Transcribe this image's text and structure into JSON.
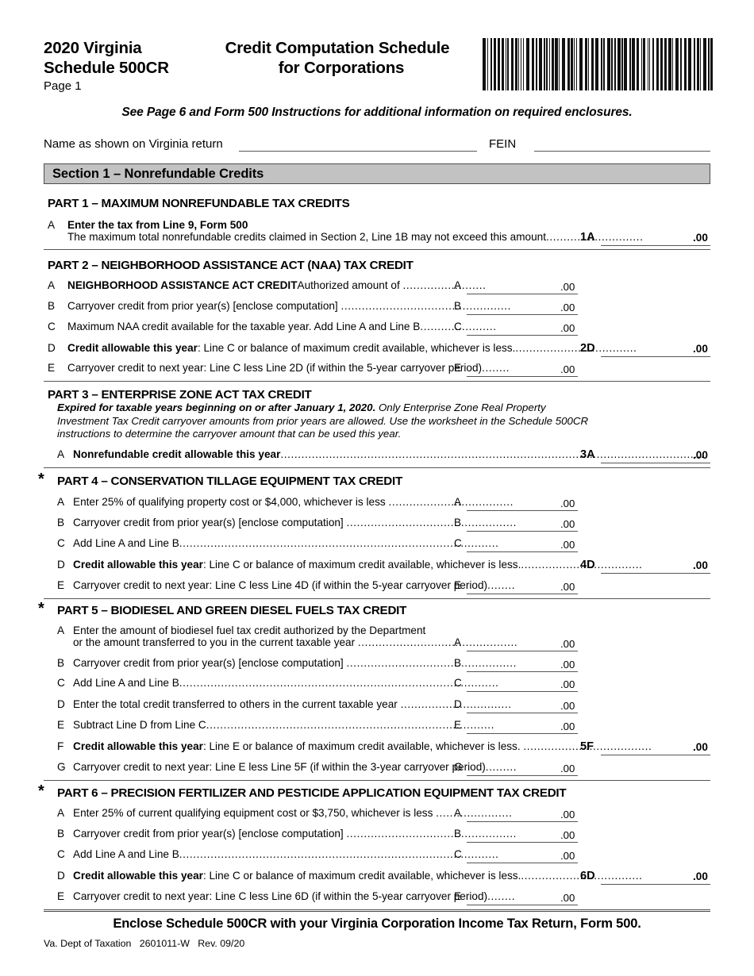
{
  "header": {
    "year_agency_line1": "2020 Virginia",
    "year_agency_line2": "Schedule 500CR",
    "page_label": "Page 1",
    "title_line1": "Credit Computation Schedule",
    "title_line2": "for Corporations",
    "barcode_name": "barcode"
  },
  "subtitle": "See Page 6 and Form 500 Instructions for additional information on required enclosures.",
  "identification": {
    "name_label": "Name as shown on Virginia return",
    "name_value": "",
    "fein_label": "FEIN",
    "fein_value": ""
  },
  "section": {
    "label": "Section 1 – Nonrefundable Credits"
  },
  "parts": [
    {
      "id": "part-1",
      "star": "",
      "title": "PART 1 – MAXIMUM NONREFUNDABLE TAX CREDITS",
      "note": "",
      "rows": [
        {
          "letter": "A",
          "text_bold": "Enter the tax from Line 9, Form 500",
          "text": "",
          "dots": "",
          "box_letter": "",
          "cents": "",
          "kind": "heading-line"
        },
        {
          "letter": "",
          "text_bold": "",
          "text": "The maximum total nonrefundable credits claimed in Section 2, Line 1B may not exceed this amount",
          "dots": "............................",
          "box_letter": "1A",
          "cents": ".00",
          "kind": "long"
        }
      ]
    },
    {
      "id": "part-2",
      "star": "",
      "title": "PART 2 – NEIGHBORHOOD ASSISTANCE ACT (NAA) TAX CREDIT",
      "note": "",
      "rows": [
        {
          "letter": "A",
          "text_bold": "",
          "text": "Authorized amount of ",
          "text_strong": "NEIGHBORHOOD ASSISTANCE ACT CREDIT",
          "dots": " ........................",
          "box_letter": "A",
          "cents": ".00",
          "kind": "short"
        },
        {
          "letter": "B",
          "text": "Carryover credit from prior year(s) [enclose computation] ",
          "dots": ".................................................",
          "box_letter": "B",
          "cents": ".00",
          "kind": "short"
        },
        {
          "letter": "C",
          "text": "Maximum NAA credit available for the taxable year. Add Line A and Line B",
          "dots": "......................",
          "box_letter": "C",
          "cents": ".00",
          "kind": "short"
        },
        {
          "letter": "D",
          "text_strong": "Credit allowable this year",
          "text": ": Line C or balance of maximum credit available, whichever is less.",
          "dots": "...................................",
          "box_letter": "2D",
          "cents": ".00",
          "kind": "long"
        },
        {
          "letter": "E",
          "text": "Carryover credit to next year: Line C less Line 2D (if within the 5-year carryover period)",
          "dots": "........",
          "box_letter": "E",
          "cents": ".00",
          "kind": "short"
        }
      ]
    },
    {
      "id": "part-3",
      "star": "",
      "title": "PART 3 – ENTERPRISE ZONE ACT TAX CREDIT",
      "note_bold": "Expired for taxable years beginning on or after January 1, 2020.",
      "note": " Only Enterprise Zone Real Property Investment Tax Credit carryover amounts from prior years are allowed. Use the worksheet in the Schedule 500CR instructions to determine the carryover amount that can be used this year.",
      "rows": [
        {
          "letter": "A",
          "text_strong": "Nonrefundable credit allowable this year",
          "text": "",
          "dots": "..........................................................................................................................",
          "box_letter": "3A",
          "cents": ".00",
          "kind": "long"
        }
      ]
    },
    {
      "id": "part-4",
      "star": "*",
      "title": "PART 4 – CONSERVATION TILLAGE EQUIPMENT TAX CREDIT",
      "note": "",
      "rows": [
        {
          "letter": "A",
          "text": "Enter 25% of qualifying property cost or $4,000, whichever is less ",
          "dots": "....................................",
          "box_letter": "A",
          "cents": ".00",
          "kind": "short"
        },
        {
          "letter": "B",
          "text": "Carryover credit from prior year(s) [enclose computation] ",
          "dots": ".................................................",
          "box_letter": "B",
          "cents": ".00",
          "kind": "short"
        },
        {
          "letter": "C",
          "text": "Add Line A and Line B",
          "dots": "............................................................................................",
          "box_letter": "C",
          "cents": ".00",
          "kind": "short"
        },
        {
          "letter": "D",
          "text_strong": "Credit allowable this year",
          "text": ": Line C or balance of maximum credit available, whichever is less.",
          "dots": "...................................",
          "box_letter": "4D",
          "cents": ".00",
          "kind": "long"
        },
        {
          "letter": "E",
          "text": "Carryover credit to next year: Line C less Line 4D (if within the 5-year carryover period)",
          "dots": "........",
          "box_letter": "E",
          "cents": ".00",
          "kind": "short"
        }
      ]
    },
    {
      "id": "part-5",
      "star": "*",
      "title": "PART 5 – BIODIESEL AND GREEN DIESEL FUELS TAX CREDIT",
      "note": "",
      "rows": [
        {
          "letter": "A",
          "text": "Enter the amount of biodiesel fuel tax credit authorized by the Department",
          "dots": "",
          "box_letter": "",
          "cents": "",
          "kind": "heading-line"
        },
        {
          "letter": "",
          "text": "or the amount transferred to you in the current taxable year ",
          "dots": "..............................................",
          "box_letter": "A",
          "cents": ".00",
          "kind": "short"
        },
        {
          "letter": "B",
          "text": "Carryover credit from prior year(s) [enclose computation] ",
          "dots": ".................................................",
          "box_letter": "B",
          "cents": ".00",
          "kind": "short"
        },
        {
          "letter": "C",
          "text": "Add Line A and Line B",
          "dots": "............................................................................................",
          "box_letter": "C",
          "cents": ".00",
          "kind": "short"
        },
        {
          "letter": "D",
          "text": "Enter the total credit transferred to others in the current taxable year ",
          "dots": "................................",
          "box_letter": "D",
          "cents": ".00",
          "kind": "short"
        },
        {
          "letter": "E",
          "text": "Subtract Line D from Line C",
          "dots": "...................................................................................",
          "box_letter": "E",
          "cents": ".00",
          "kind": "short"
        },
        {
          "letter": "F",
          "text_strong": "Credit allowable this year",
          "text": ": Line E or balance of maximum credit available, whichever is less. ",
          "dots": ".....................................",
          "box_letter": "5F",
          "cents": ".00",
          "kind": "long"
        },
        {
          "letter": "G",
          "text": "Carryover credit to next year: Line E less Line 5F (if within the 3-year carryover period)",
          "dots": ".........",
          "box_letter": "G",
          "cents": ".00",
          "kind": "short"
        }
      ]
    },
    {
      "id": "part-6",
      "star": "*",
      "title": "PART 6 – PRECISION FERTILIZER AND PESTICIDE APPLICATION EQUIPMENT TAX CREDIT",
      "note": "",
      "rows": [
        {
          "letter": "A",
          "text": "Enter 25% of current qualifying equipment cost or $3,750, whichever is less ",
          "dots": "......................",
          "box_letter": "A",
          "cents": ".00",
          "kind": "short"
        },
        {
          "letter": "B",
          "text": "Carryover credit from prior year(s) [enclose computation] ",
          "dots": ".................................................",
          "box_letter": "B",
          "cents": ".00",
          "kind": "short"
        },
        {
          "letter": "C",
          "text": "Add Line A and Line B",
          "dots": "............................................................................................",
          "box_letter": "C",
          "cents": ".00",
          "kind": "short"
        },
        {
          "letter": "D",
          "text_strong": "Credit allowable this year",
          "text": ": Line C or balance of maximum credit available, whichever is less.",
          "dots": "...................................",
          "box_letter": "6D",
          "cents": ".00",
          "kind": "long"
        },
        {
          "letter": "E",
          "text": "Carryover credit to next year: Line C less Line 6D (if within the 5-year carryover period)",
          "dots": "........",
          "box_letter": "E",
          "cents": ".00",
          "kind": "short"
        }
      ]
    }
  ],
  "footer": {
    "enclose_note": "Enclose Schedule 500CR with your Virginia Corporation Income Tax Return, Form 500.",
    "agency": "Va. Dept of Taxation",
    "form_number": "2601011-W",
    "revision": "Rev. 09/20"
  },
  "colors": {
    "section_bar_fill": "#c2c2c2",
    "rule": "#555555",
    "text": "#000000"
  }
}
